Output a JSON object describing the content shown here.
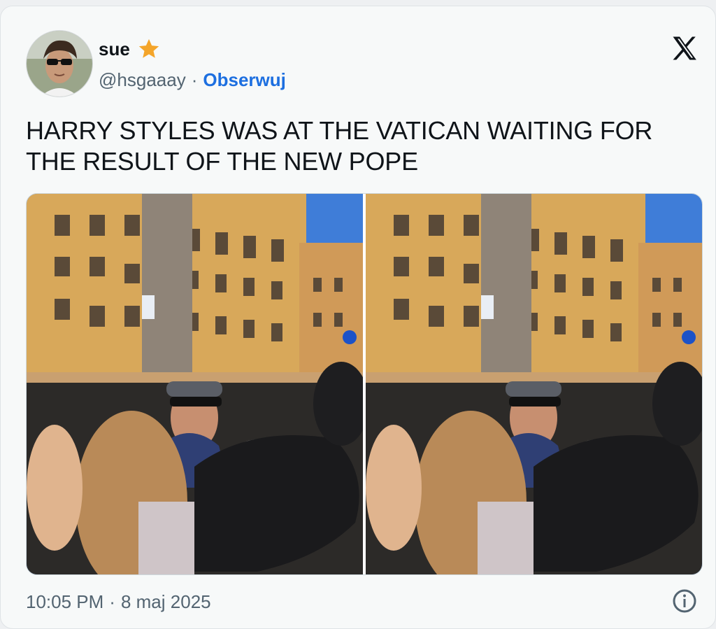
{
  "author": {
    "display_name": "sue",
    "handle": "@hsgaaay",
    "separator": "·",
    "follow_label": "Obserwuj",
    "verified_icon": "star-icon",
    "star_color": "#f4a52a"
  },
  "tweet": {
    "text": "HARRY STYLES WAS AT THE VATICAN WAITING FOR THE RESULT OF THE NEW POPE",
    "time": "10:05 PM",
    "separator": "·",
    "date": "8 maj 2025"
  },
  "media": {
    "photos": [
      {
        "description_icon": "photo"
      },
      {
        "description_icon": "photo"
      }
    ]
  },
  "icons": {
    "brand": "x-logo-icon",
    "info": "info-icon"
  },
  "colors": {
    "link": "#1d6fe0",
    "muted": "#536471",
    "text": "#0f1419"
  }
}
